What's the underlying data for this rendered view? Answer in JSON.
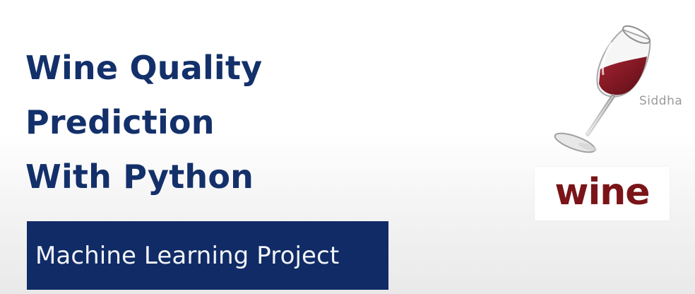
{
  "title": {
    "line1": "Wine Quality",
    "line2": "Prediction",
    "line3": "With Python"
  },
  "subtitle": "Machine Learning Project",
  "author_partial": "Siddha",
  "logo_text": "wine",
  "colors": {
    "title": "#13306a",
    "subtitle_box": "#102b66",
    "subtitle_text": "#f2f4f8",
    "wine_red": "#7a1418"
  },
  "icons": {
    "glass": "wine-glass-icon"
  }
}
